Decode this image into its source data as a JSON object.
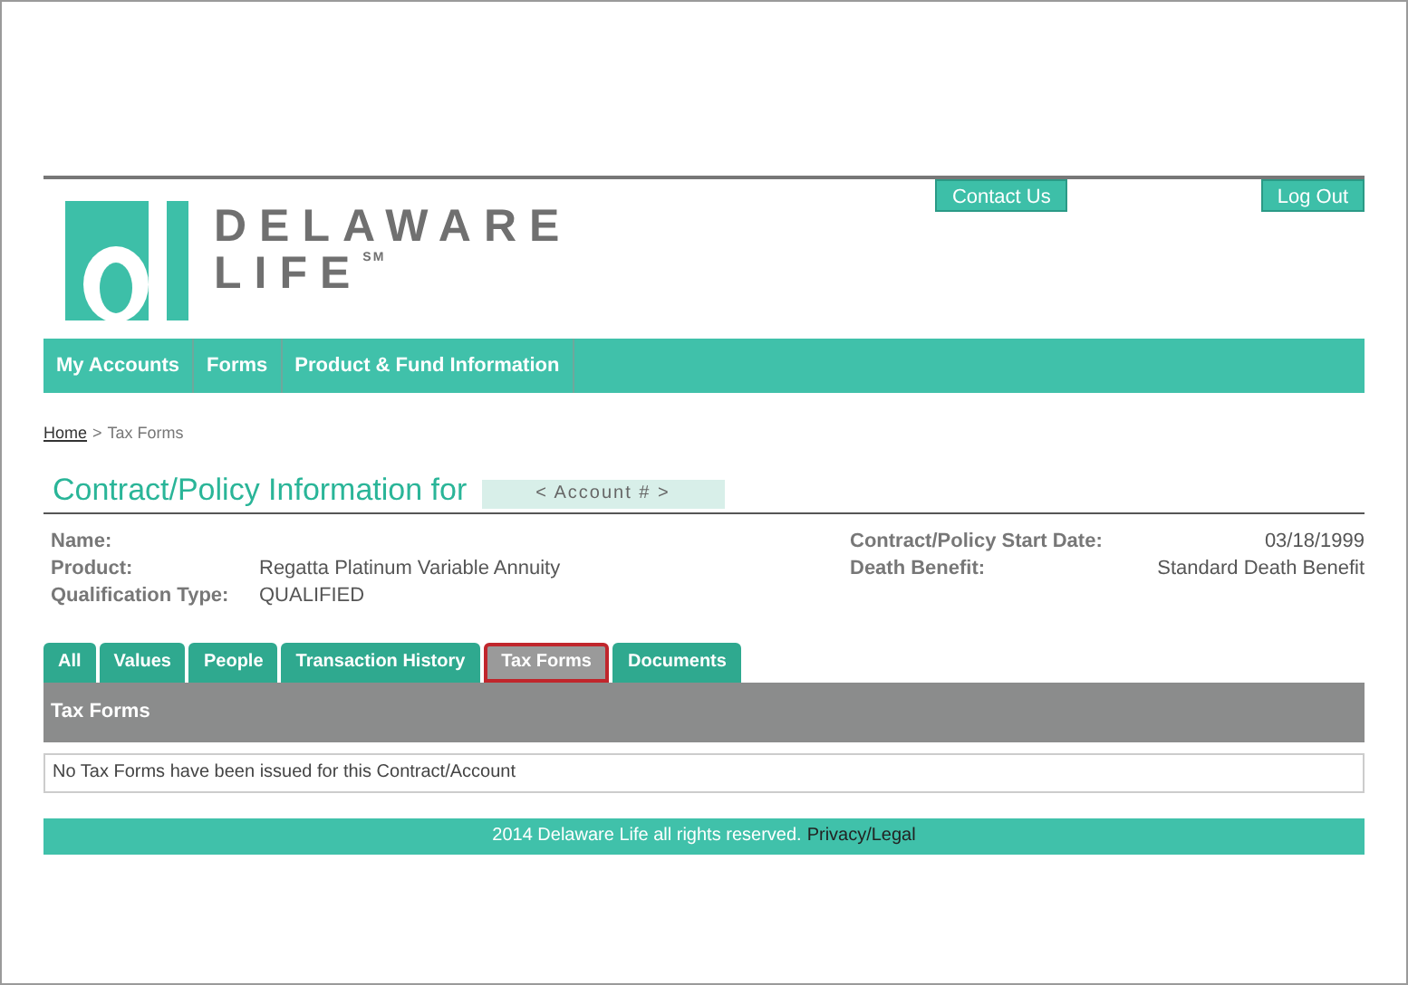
{
  "header": {
    "logo_line1": "DELAWARE",
    "logo_line2": "LIFE",
    "logo_mark": "SM",
    "buttons": [
      "Contact Us",
      "Log Out"
    ]
  },
  "nav": [
    "My Accounts",
    "Forms",
    "Product & Fund Information"
  ],
  "breadcrumb": {
    "home": "Home",
    "separator": ">",
    "current": "Tax Forms"
  },
  "title": {
    "text": "Contract/Policy Information for",
    "account": "< Account # >"
  },
  "info_left": [
    {
      "label": "Name:"
    },
    {
      "label": "Product:",
      "value": "Regatta Platinum Variable Annuity"
    },
    {
      "label": "Qualification Type:",
      "value": "QUALIFIED"
    }
  ],
  "info_right": [
    {
      "label": "Contract/Policy Start Date:",
      "value": "03/18/1999"
    },
    {
      "label": "Death Benefit:",
      "value": "Standard Death Benefit"
    }
  ],
  "tabs": [
    {
      "label": "All",
      "selected": false
    },
    {
      "label": "Values",
      "selected": false
    },
    {
      "label": "People",
      "selected": false
    },
    {
      "label": "Transaction History",
      "selected": false
    },
    {
      "label": "Tax Forms",
      "selected": true
    },
    {
      "label": "Documents",
      "selected": false
    }
  ],
  "panel": {
    "heading": "Tax Forms",
    "message": "No Tax Forms have been issued for this Contract/Account"
  },
  "footer": {
    "text": "2014 Delaware Life all rights reserved.",
    "link": "Privacy/Legal"
  }
}
